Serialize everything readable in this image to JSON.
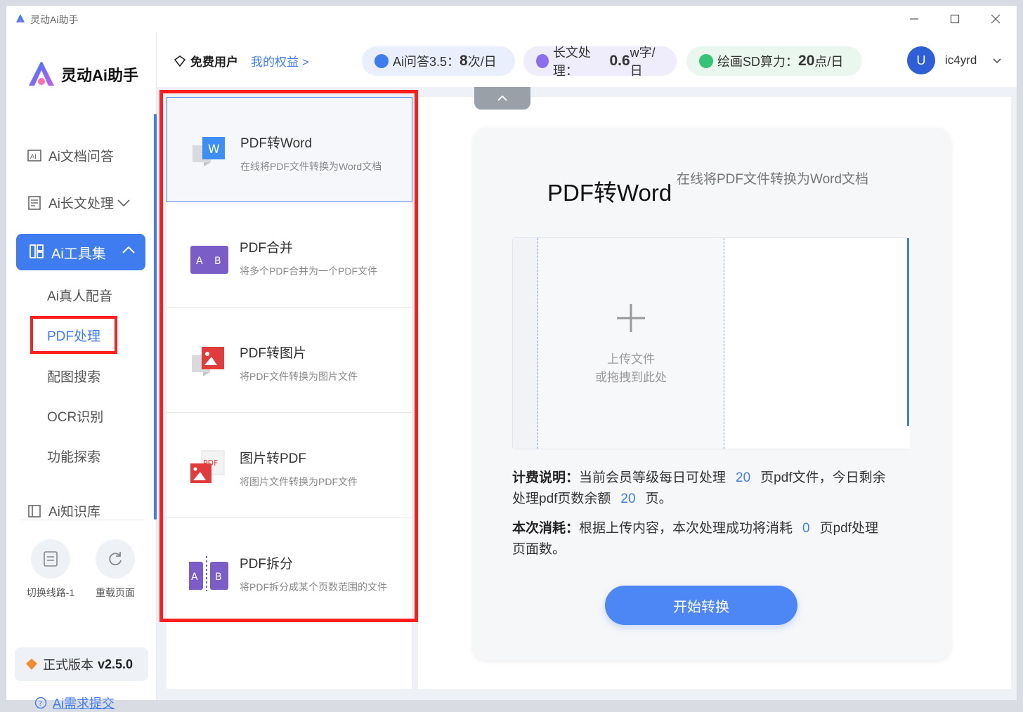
{
  "window": {
    "title": "灵动Ai助手"
  },
  "sidebar": {
    "logo_text": "灵动Ai助手",
    "items": [
      {
        "label": "Ai文档问答"
      },
      {
        "label": "Ai长文处理"
      },
      {
        "label": "Ai工具集"
      }
    ],
    "sub_items": [
      {
        "label": "Ai真人配音"
      },
      {
        "label": "PDF处理"
      },
      {
        "label": "配图搜索"
      },
      {
        "label": "OCR识别"
      },
      {
        "label": "功能探索"
      }
    ],
    "knowledge": "Ai知识库",
    "switch_line": "切换线路-1",
    "reload": "重载页面",
    "version_label": "正式版本",
    "version": "v2.5.0",
    "feedback": "Ai需求提交"
  },
  "header": {
    "user_type": "免费用户",
    "rights": "我的权益 >",
    "quota1_label": "Ai问答3.5：",
    "quota1_value": "8",
    "quota1_unit": "次/日",
    "quota2_label": "长文处理：",
    "quota2_value": "0.6",
    "quota2_unit": "w字/日",
    "quota3_label": "绘画SD算力：",
    "quota3_value": "20",
    "quota3_unit": "点/日",
    "avatar": "U",
    "username": "ic4yrd"
  },
  "tools": [
    {
      "name": "PDF转Word",
      "desc": "在线将PDF文件转换为Word文档"
    },
    {
      "name": "PDF合并",
      "desc": "将多个PDF合并为一个PDF文件"
    },
    {
      "name": "PDF转图片",
      "desc": "将PDF文件转换为图片文件"
    },
    {
      "name": "图片转PDF",
      "desc": "将图片文件转换为PDF文件"
    },
    {
      "name": "PDF拆分",
      "desc": "将PDF拆分成某个页数范围的文件"
    }
  ],
  "main": {
    "title": "PDF转Word",
    "subtitle": "在线将PDF文件转换为Word文档",
    "upload_line1": "上传文件",
    "upload_line2": "或拖拽到此处",
    "billing_label": "计费说明：",
    "billing_text1": "当前会员等级每日可处理",
    "billing_num1": "20",
    "billing_text2": "页pdf文件，今日剩余处理pdf页数余额",
    "billing_num2": "20",
    "billing_text3": "页。",
    "consume_label": "本次消耗：",
    "consume_text1": "根据上传内容，本次处理成功将消耗",
    "consume_num": "0",
    "consume_text2": "页pdf处理页面数。",
    "start_button": "开始转换"
  },
  "colors": {
    "accent": "#3f7cf0",
    "highlight": "#ff1e1e"
  }
}
